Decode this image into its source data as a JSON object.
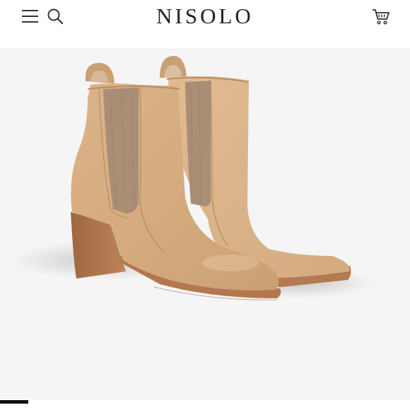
{
  "header": {
    "logo_text": "NISOLO",
    "icons": [
      "menu-icon",
      "search-icon",
      "cart-icon"
    ]
  },
  "product": {
    "image": "tan-leather-chelsea-boots",
    "colors": {
      "leather": "#d3a97c",
      "elastic": "#a98d75",
      "heel": "#b37750",
      "background": "#f5f5f5"
    }
  },
  "carousel": {
    "active_index": 1
  }
}
